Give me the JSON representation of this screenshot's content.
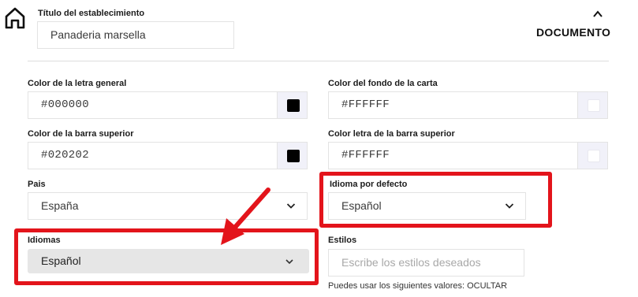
{
  "icons": {
    "home": "home-icon",
    "collapse": "chevron-up-icon",
    "dropdown": "chevron-down-icon"
  },
  "header": {
    "title_label": "Título del establecimiento",
    "title_value": "Panaderia marsella",
    "section": "DOCUMENTO"
  },
  "colors_form": {
    "general_text": {
      "label": "Color de la letra general",
      "value": "#000000",
      "swatch": "#000000"
    },
    "card_bg": {
      "label": "Color del fondo de la carta",
      "value": "#FFFFFF",
      "swatch": "#FFFFFF"
    },
    "topbar": {
      "label": "Color de la barra superior",
      "value": "#020202",
      "swatch": "#020202"
    },
    "topbar_text": {
      "label": "Color letra de la barra superior",
      "value": "#FFFFFF",
      "swatch": "#FFFFFF"
    }
  },
  "locale_form": {
    "country": {
      "label": "Pais",
      "value": "España"
    },
    "default_language": {
      "label": "Idioma por defecto",
      "value": "Español"
    },
    "languages": {
      "label": "Idiomas",
      "value": "Español"
    },
    "styles": {
      "label": "Estilos",
      "placeholder": "Escribe los estilos deseados",
      "hint": "Puedes usar los siguientes valores: OCULTAR"
    }
  },
  "annotation_color": "#E3141B"
}
